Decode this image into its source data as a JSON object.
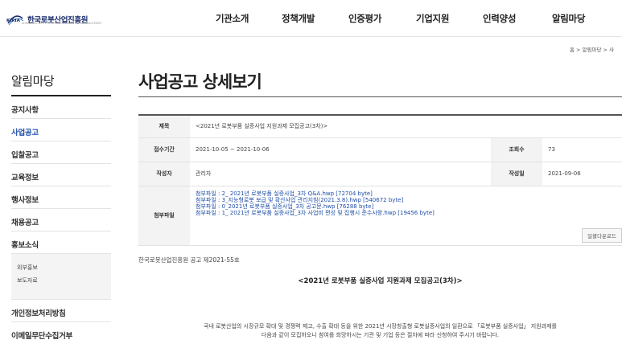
{
  "header": {
    "logo_text": "한국로봇산업진흥원",
    "logo_mark": "KIRIA",
    "logo_sub": "KOREA INSTITUTE FOR ROBOT INDUSTRY ADVANCEMENT",
    "nav": [
      "기관소개",
      "정책개발",
      "인증평가",
      "기업지원",
      "인력양성",
      "알림마당"
    ]
  },
  "breadcrumb": "홈 > 알림마당 > 사",
  "sidebar": {
    "title": "알림마당",
    "items": [
      "공지사항",
      "사업공고",
      "입찰공고",
      "교육정보",
      "행사정보",
      "채용공고",
      "홍보소식"
    ],
    "sub_items": [
      "외부홍보",
      "보도자료"
    ],
    "bottom_items": [
      "개인정보처리방침",
      "이메일무단수집거부"
    ]
  },
  "page": {
    "title": "사업공고 상세보기"
  },
  "detail": {
    "subject_label": "제목",
    "subject": "<2021년 로봇부품 실증사업 지원과제 모집공고(3차)>",
    "period_label": "접수기간",
    "period": "2021-10-05 ~ 2021-10-06",
    "views_label": "조회수",
    "views": "73",
    "author_label": "작성자",
    "author": "관리자",
    "date_label": "작성일",
    "date": "2021-09-06",
    "files_label": "첨부파일",
    "files": [
      "첨부파일 : 2_ 2021년 로봇부품 실증사업_3차 Q&A.hwp [72704 byte]",
      "첨부파일 : 3_지능형로봇 보급 및 확산사업 관리지침(2021.3.8).hwp [540672 byte]",
      "첨부파일 : 0_2021년 로봇부품 실증사업_3차 공고문.hwp [76288 byte]",
      "첨부파일 : 1_ 2021년 로봇부품 실증사업_3차 사업비 편성 및 집행시 준수사항.hwp [19456 byte]"
    ],
    "download_all": "일괄다운로드"
  },
  "notice": {
    "number": "한국로봇산업진흥원 공고 제2021-55호",
    "title": "<2021년 로봇부품 실증사업 지원과제 모집공고(3차)>",
    "body_line1": "국내 로봇산업의 시장규모 확대 및 경쟁력 제고, 수출 확대 등을 위한 2021년 시장창출형 로봇실증사업의 일환으로 「로봇부품 실증사업」 지원과제를",
    "body_line2": "다음과 같이 모집하오니 참여를 희망하시는 기관 및 기업 등은 절차에 따라 신청하여 주시기 바랍니다."
  },
  "colors": {
    "brand_blue": "#1f4fa8",
    "logo_navy": "#1a2d6b"
  }
}
